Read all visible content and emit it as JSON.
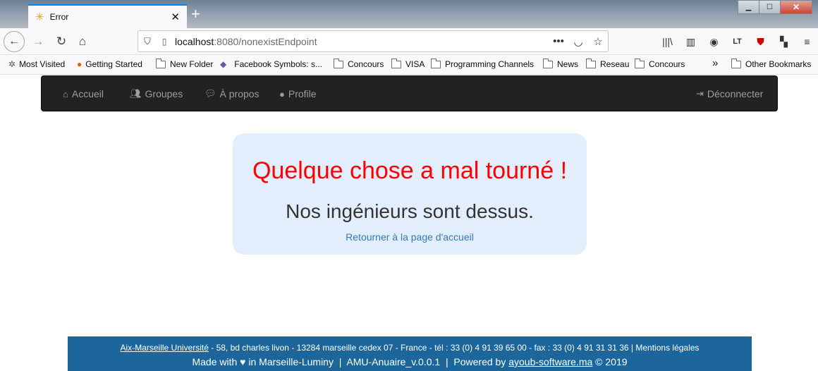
{
  "browser": {
    "tab_title": "Error",
    "url_host": "localhost",
    "url_path": ":8080/nonexistEndpoint",
    "bookmarks": [
      "Most Visited",
      "Getting Started",
      "New Folder",
      "Facebook Symbols: s...",
      "Concours",
      "VISA",
      "Programming Channels",
      "News",
      "Reseau",
      "Concours"
    ],
    "other_bookmarks": "Other Bookmarks",
    "lt_label": "LT"
  },
  "nav": {
    "home": "Accueil",
    "groups": "Groupes",
    "about": "À propos",
    "profile": "Profile",
    "logout": "Déconnecter"
  },
  "error": {
    "title": "Quelque chose a mal tourné !",
    "subtitle": "Nos ingénieurs sont dessus.",
    "link": "Retourner à la page d'accueil"
  },
  "footer": {
    "university": "Aix-Marseille Université",
    "address": " - 58, bd charles livon - 13284 marseille cedex 07 - France - tél : 33 (0) 4 91 39 65 00 - fax : 33 (0) 4 91 31 31 36 | Mentions légales",
    "made_with": "Made with",
    "location": " in Marseille-Luminy  |  AMU-Anuaire_v.0.0.1  |  Powered by ",
    "powered_site": "ayoub-software.ma",
    "copyright": " © 2019"
  },
  "colors": {
    "error_red": "#ff0000",
    "link_blue": "#337ab7",
    "footer_bg": "#1c669b",
    "navbar_bg": "#222222",
    "box_bg": "#e3eefd"
  }
}
